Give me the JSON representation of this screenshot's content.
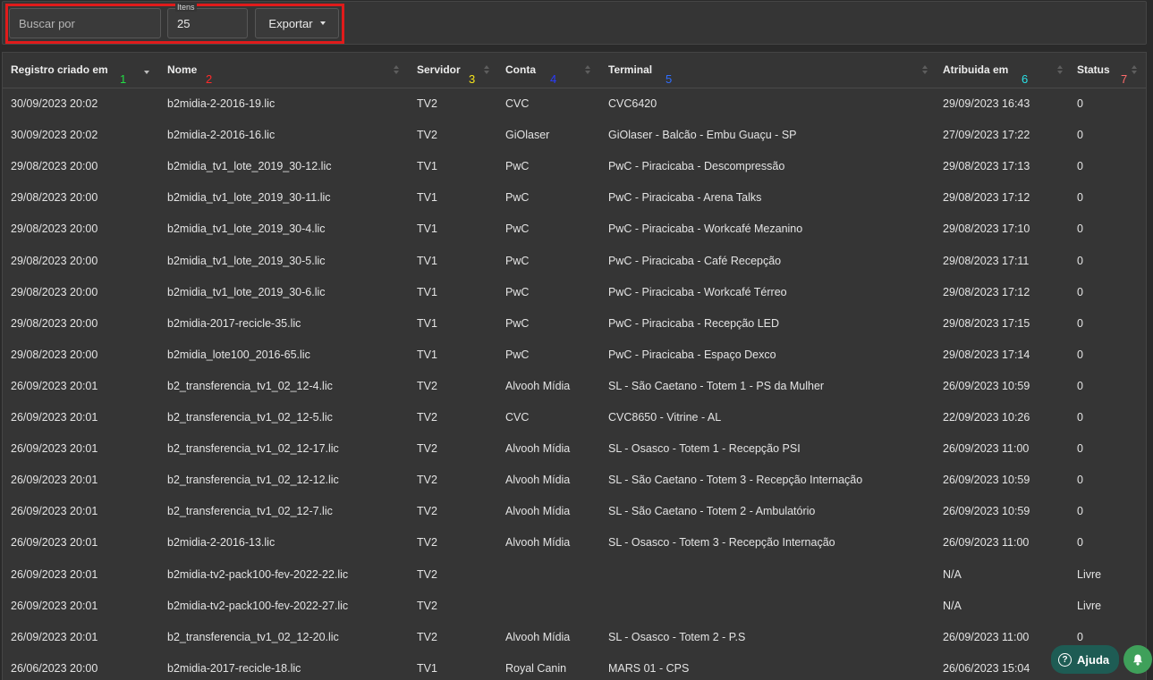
{
  "toolbar": {
    "search_placeholder": "Buscar por",
    "items_label": "Itens",
    "items_value": "25",
    "export_label": "Exportar"
  },
  "columns": [
    {
      "label": "Registro criado em",
      "num": "1",
      "num_color": "#22dd44"
    },
    {
      "label": "Nome",
      "num": "2",
      "num_color": "#ff2a2a"
    },
    {
      "label": "Servidor",
      "num": "3",
      "num_color": "#f4e31c"
    },
    {
      "label": "Conta",
      "num": "4",
      "num_color": "#2a3cff"
    },
    {
      "label": "Terminal",
      "num": "5",
      "num_color": "#2f6dff"
    },
    {
      "label": "Atribuida em",
      "num": "6",
      "num_color": "#2ae0e6"
    },
    {
      "label": "Status",
      "num": "7",
      "num_color": "#ff6b6b"
    }
  ],
  "rows": [
    [
      "30/09/2023 20:02",
      "b2midia-2-2016-19.lic",
      "TV2",
      "CVC",
      "CVC6420",
      "29/09/2023 16:43",
      "0"
    ],
    [
      "30/09/2023 20:02",
      "b2midia-2-2016-16.lic",
      "TV2",
      "GiOlaser",
      "GiOlaser - Balcão - Embu Guaçu - SP",
      "27/09/2023 17:22",
      "0"
    ],
    [
      "29/08/2023 20:00",
      "b2midia_tv1_lote_2019_30-12.lic",
      "TV1",
      "PwC",
      "PwC - Piracicaba - Descompressão",
      "29/08/2023 17:13",
      "0"
    ],
    [
      "29/08/2023 20:00",
      "b2midia_tv1_lote_2019_30-11.lic",
      "TV1",
      "PwC",
      "PwC - Piracicaba - Arena Talks",
      "29/08/2023 17:12",
      "0"
    ],
    [
      "29/08/2023 20:00",
      "b2midia_tv1_lote_2019_30-4.lic",
      "TV1",
      "PwC",
      "PwC - Piracicaba - Workcafé Mezanino",
      "29/08/2023 17:10",
      "0"
    ],
    [
      "29/08/2023 20:00",
      "b2midia_tv1_lote_2019_30-5.lic",
      "TV1",
      "PwC",
      "PwC - Piracicaba - Café Recepção",
      "29/08/2023 17:11",
      "0"
    ],
    [
      "29/08/2023 20:00",
      "b2midia_tv1_lote_2019_30-6.lic",
      "TV1",
      "PwC",
      "PwC - Piracicaba - Workcafé Térreo",
      "29/08/2023 17:12",
      "0"
    ],
    [
      "29/08/2023 20:00",
      "b2midia-2017-recicle-35.lic",
      "TV1",
      "PwC",
      "PwC - Piracicaba - Recepção LED",
      "29/08/2023 17:15",
      "0"
    ],
    [
      "29/08/2023 20:00",
      "b2midia_lote100_2016-65.lic",
      "TV1",
      "PwC",
      "PwC - Piracicaba - Espaço Dexco",
      "29/08/2023 17:14",
      "0"
    ],
    [
      "26/09/2023 20:01",
      "b2_transferencia_tv1_02_12-4.lic",
      "TV2",
      "Alvooh Mídia",
      "SL - São Caetano - Totem 1 - PS da Mulher",
      "26/09/2023 10:59",
      "0"
    ],
    [
      "26/09/2023 20:01",
      "b2_transferencia_tv1_02_12-5.lic",
      "TV2",
      "CVC",
      "CVC8650 - Vitrine - AL",
      "22/09/2023 10:26",
      "0"
    ],
    [
      "26/09/2023 20:01",
      "b2_transferencia_tv1_02_12-17.lic",
      "TV2",
      "Alvooh Mídia",
      "SL - Osasco - Totem 1 - Recepção PSI",
      "26/09/2023 11:00",
      "0"
    ],
    [
      "26/09/2023 20:01",
      "b2_transferencia_tv1_02_12-12.lic",
      "TV2",
      "Alvooh Mídia",
      "SL - São Caetano - Totem 3 - Recepção Internação",
      "26/09/2023 10:59",
      "0"
    ],
    [
      "26/09/2023 20:01",
      "b2_transferencia_tv1_02_12-7.lic",
      "TV2",
      "Alvooh Mídia",
      "SL - São Caetano - Totem 2 - Ambulatório",
      "26/09/2023 10:59",
      "0"
    ],
    [
      "26/09/2023 20:01",
      "b2midia-2-2016-13.lic",
      "TV2",
      "Alvooh Mídia",
      "SL - Osasco - Totem 3 - Recepção Internação",
      "26/09/2023 11:00",
      "0"
    ],
    [
      "26/09/2023 20:01",
      "b2midia-tv2-pack100-fev-2022-22.lic",
      "TV2",
      "",
      "",
      "N/A",
      "Livre"
    ],
    [
      "26/09/2023 20:01",
      "b2midia-tv2-pack100-fev-2022-27.lic",
      "TV2",
      "",
      "",
      "N/A",
      "Livre"
    ],
    [
      "26/09/2023 20:01",
      "b2_transferencia_tv1_02_12-20.lic",
      "TV2",
      "Alvooh Mídia",
      "SL - Osasco - Totem 2 - P.S",
      "26/09/2023 11:00",
      "0"
    ],
    [
      "26/06/2023 20:00",
      "b2midia-2017-recicle-18.lic",
      "TV1",
      "Royal Canin",
      "MARS 01 - CPS",
      "26/06/2023 15:04",
      "0"
    ]
  ],
  "help": {
    "label": "Ajuda",
    "icon": "question-circle-icon"
  },
  "notifications": {
    "icon": "bell-icon"
  }
}
